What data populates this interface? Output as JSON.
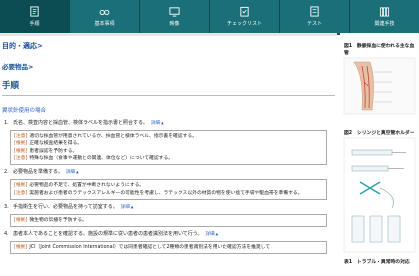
{
  "tabs": [
    {
      "label": "手順",
      "icon": "document-icon",
      "active": true
    },
    {
      "label": "基本事項",
      "icon": "glasses-icon",
      "active": false
    },
    {
      "label": "映像",
      "icon": "monitor-icon",
      "active": false
    },
    {
      "label": "チェックリスト",
      "icon": "clipboard-check-icon",
      "active": false
    },
    {
      "label": "テスト",
      "icon": "test-sheet-icon",
      "active": false
    },
    {
      "label": "関連手技",
      "icon": "books-icon",
      "active": false
    }
  ],
  "breadcrumb": "目的・適応>",
  "subheading": "必要物品>",
  "page_title": "手順",
  "expand_all": "すべての根拠を見る",
  "section_title": "翼状針使用の場合",
  "more_label": "詳細",
  "steps": [
    {
      "num": "1.",
      "text": "氏名、検査内容と採血管、検体ラベルを指示書と照合する。",
      "notes": [
        {
          "tag": "[注意]",
          "text": "適切な採血管が用意されているか、採血管と検体ラベル、指示書を確認する。"
        },
        {
          "tag": "[根拠]",
          "text": "正確な検査結果を得る。"
        },
        {
          "tag": "[根拠]",
          "text": "患者誤認を予防する。"
        },
        {
          "tag": "[注意]",
          "text": "特殊な採血（食事や運動との関連、体位など）について確認する。"
        }
      ]
    },
    {
      "num": "2.",
      "text": "必要物品を準備する。",
      "notes": [
        {
          "tag": "[根拠]",
          "text": "必要物品の不足で、処置が中断されないようにする。"
        },
        {
          "tag": "[注意]",
          "text": "実施者および患者のラテックスアレルギーの可能性を考慮し、ラテックス以外の材質の物を使い捨て手袋や駆血帯を準備する。"
        }
      ]
    },
    {
      "num": "3.",
      "text": "手指衛生を行い、必要物品を持って訪室する。",
      "notes": [
        {
          "tag": "[根拠]",
          "text": "微生物の伝播を予防する。"
        }
      ]
    },
    {
      "num": "4.",
      "text": "患者本人であることを確認する。施設の規準に従い患者の患者識別法を用いて行う。",
      "notes": [
        {
          "tag": "[根拠]",
          "text": "JCI（Joint Commission International）では同患者確認として2種類の患者識別法を用いた確認方法を推奨して"
        }
      ]
    }
  ],
  "sidebar": {
    "fig1_title": "図1　静脈採血に使われる主な血管",
    "fig2_title": "図2　シリンジと真空管ホルダー",
    "fig3_title": "表1　トラブル・異常時の対応"
  },
  "colors": {
    "tab_bar": "#1b6f78",
    "active_tab": "#0c4c53",
    "heading": "#1a4f9c",
    "link": "#2a62c8",
    "tag": "#c06020"
  }
}
